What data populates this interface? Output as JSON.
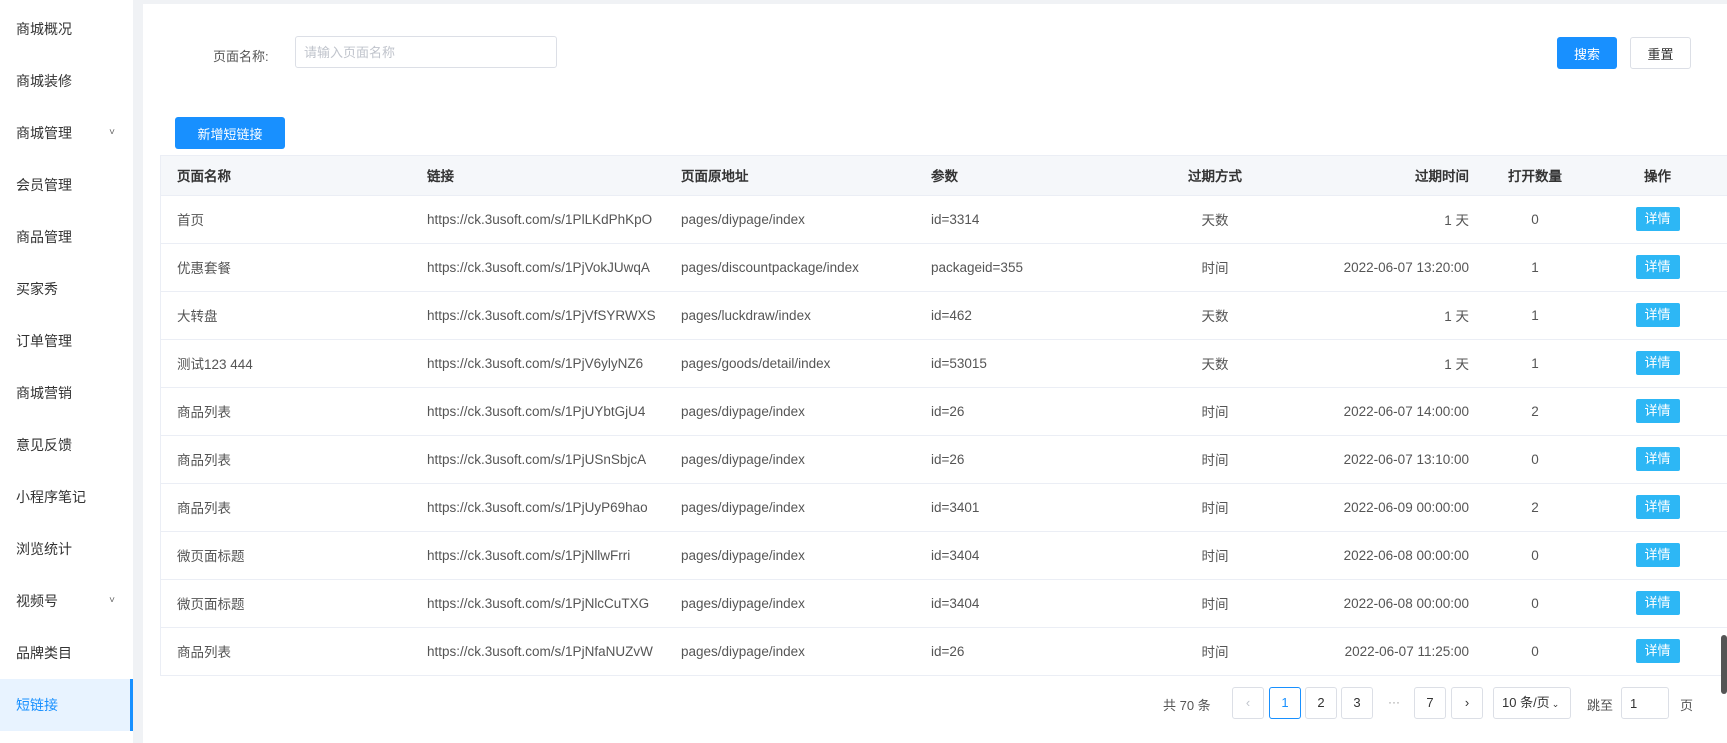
{
  "sidebar": {
    "items": [
      {
        "label": "商城概况"
      },
      {
        "label": "商城装修"
      },
      {
        "label": "商城管理",
        "chevron": "chevron-down-icon"
      },
      {
        "label": "会员管理"
      },
      {
        "label": "商品管理"
      },
      {
        "label": "买家秀"
      },
      {
        "label": "订单管理"
      },
      {
        "label": "商城营销"
      },
      {
        "label": "意见反馈"
      },
      {
        "label": "小程序笔记"
      },
      {
        "label": "浏览统计"
      },
      {
        "label": "视频号",
        "chevron": "chevron-down-icon"
      },
      {
        "label": "品牌类目"
      },
      {
        "label": "短链接",
        "active": true
      }
    ]
  },
  "search": {
    "label": "页面名称:",
    "placeholder": "请输入页面名称",
    "value": "",
    "search_button": "搜索",
    "reset_button": "重置"
  },
  "toolbar": {
    "add_button": "新增短链接"
  },
  "table": {
    "columns": [
      "页面名称",
      "链接",
      "页面原地址",
      "参数",
      "过期方式",
      "过期时间",
      "打开数量",
      "操作"
    ],
    "action_label": "详情",
    "rows": [
      {
        "name": "首页",
        "link": "https://ck.3usoft.com/s/1PlLKdPhKpO",
        "path": "pages/diypage/index",
        "params": "id=3314",
        "expire_type": "天数",
        "expire_time": "1 天",
        "opens": "0"
      },
      {
        "name": "优惠套餐",
        "link": "https://ck.3usoft.com/s/1PjVokJUwqA",
        "path": "pages/discountpackage/index",
        "params": "packageid=355",
        "expire_type": "时间",
        "expire_time": "2022-06-07 13:20:00",
        "opens": "1"
      },
      {
        "name": "大转盘",
        "link": "https://ck.3usoft.com/s/1PjVfSYRWXS",
        "path": "pages/luckdraw/index",
        "params": "id=462",
        "expire_type": "天数",
        "expire_time": "1 天",
        "opens": "1"
      },
      {
        "name": "测试123 444",
        "link": "https://ck.3usoft.com/s/1PjV6ylyNZ6",
        "path": "pages/goods/detail/index",
        "params": "id=53015",
        "expire_type": "天数",
        "expire_time": "1 天",
        "opens": "1"
      },
      {
        "name": "商品列表",
        "link": "https://ck.3usoft.com/s/1PjUYbtGjU4",
        "path": "pages/diypage/index",
        "params": "id=26",
        "expire_type": "时间",
        "expire_time": "2022-06-07 14:00:00",
        "opens": "2"
      },
      {
        "name": "商品列表",
        "link": "https://ck.3usoft.com/s/1PjUSnSbjcA",
        "path": "pages/diypage/index",
        "params": "id=26",
        "expire_type": "时间",
        "expire_time": "2022-06-07 13:10:00",
        "opens": "0"
      },
      {
        "name": "商品列表",
        "link": "https://ck.3usoft.com/s/1PjUyP69hao",
        "path": "pages/diypage/index",
        "params": "id=3401",
        "expire_type": "时间",
        "expire_time": "2022-06-09 00:00:00",
        "opens": "2"
      },
      {
        "name": "微页面标题",
        "link": "https://ck.3usoft.com/s/1PjNllwFrri",
        "path": "pages/diypage/index",
        "params": "id=3404",
        "expire_type": "时间",
        "expire_time": "2022-06-08 00:00:00",
        "opens": "0"
      },
      {
        "name": "微页面标题",
        "link": "https://ck.3usoft.com/s/1PjNlcCuTXG",
        "path": "pages/diypage/index",
        "params": "id=3404",
        "expire_type": "时间",
        "expire_time": "2022-06-08 00:00:00",
        "opens": "0"
      },
      {
        "name": "商品列表",
        "link": "https://ck.3usoft.com/s/1PjNfaNUZvW",
        "path": "pages/diypage/index",
        "params": "id=26",
        "expire_type": "时间",
        "expire_time": "2022-06-07 11:25:00",
        "opens": "0"
      }
    ]
  },
  "pagination": {
    "total": "共 70 条",
    "prev_icon": "chevron-left-icon",
    "next_icon": "chevron-right-icon",
    "pages": [
      "1",
      "2",
      "3"
    ],
    "ellipsis": "···",
    "last_page": "7",
    "current": "1",
    "page_size": "10 条/页",
    "goto_label": "跳至",
    "goto_value": "1",
    "page_suffix": "页"
  }
}
